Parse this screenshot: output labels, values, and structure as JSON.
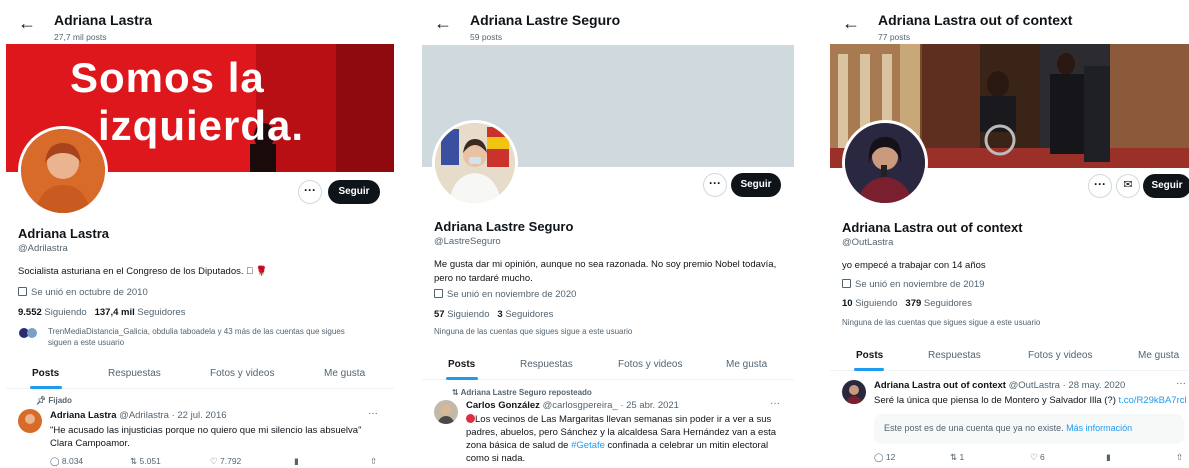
{
  "profiles": [
    {
      "header_name": "Adriana Lastra",
      "header_posts": "27,7 mil posts",
      "banner_text_1": "Somos la",
      "banner_text_2": "izquierda.",
      "more_label": "···",
      "follow_label": "Seguir",
      "display_name": "Adriana Lastra",
      "handle": "@Adrilastra",
      "bio": "Socialista asturiana en el Congreso de los Diputados. 🏻 🌹",
      "joined": "Se unió en octubre de 2010",
      "following_count": "9.552",
      "following_label": "Siguiendo",
      "followers_count": "137,4 mil",
      "followers_label": "Seguidores",
      "followers_note": "TrenMediaDistancia_Galicia, obdulia taboadela y 43 más de las cuentas que sigues siguen a este usuario",
      "tabs": [
        "Posts",
        "Respuestas",
        "Fotos y videos",
        "Me gusta"
      ],
      "pinned_label": "Fijado",
      "tweet_author": "Adriana Lastra",
      "tweet_meta": "@Adrilastra · 22 jul. 2016",
      "tweet_text": "\"He acusado las injusticias porque no quiero que mi silencio las absuelva\" Clara Campoamor.",
      "tweet_dots": "···",
      "replies": "8.034",
      "retweets": "5.051",
      "likes": "7.792"
    },
    {
      "header_name": "Adriana Lastre Seguro",
      "header_posts": "59 posts",
      "more_label": "···",
      "follow_label": "Seguir",
      "display_name": "Adriana Lastre Seguro",
      "handle": "@LastreSeguro",
      "bio": "Me gusta dar mi opinión, aunque no sea razonada. No soy premio Nobel todavía, pero no tardaré mucho.",
      "joined": "Se unió en noviembre de 2020",
      "following_count": "57",
      "following_label": "Siguiendo",
      "followers_count": "3",
      "followers_label": "Seguidores",
      "followers_note": "Ninguna de las cuentas que sigues sigue a este usuario",
      "tabs": [
        "Posts",
        "Respuestas",
        "Fotos y videos",
        "Me gusta"
      ],
      "repost_label": "Adriana Lastre Seguro reposteado",
      "tweet_author": "Carlos González",
      "tweet_meta": "@carlosgpereira_ · 25 abr. 2021",
      "tweet_text_pre": "Los vecinos de Las Margaritas llevan semanas sin poder ir a ver a sus padres, abuelos, pero Sánchez y la alcaldesa Sara Hernández van a esta zona básica de salud de ",
      "tweet_hashtag": "#Getafe",
      "tweet_text_post": " confinada a celebrar un mitin electoral como si nada.",
      "tweet_dots": "···"
    },
    {
      "header_name": "Adriana Lastra out of context",
      "header_posts": "77 posts",
      "more_label": "···",
      "follow_label": "Seguir",
      "display_name": "Adriana Lastra out of context",
      "handle": "@OutLastra",
      "bio": "yo empecé a trabajar con 14 años",
      "joined": "Se unió en noviembre de 2019",
      "following_count": "10",
      "following_label": "Siguiendo",
      "followers_count": "379",
      "followers_label": "Seguidores",
      "followers_note": "Ninguna de las cuentas que sigues sigue a este usuario",
      "tabs": [
        "Posts",
        "Respuestas",
        "Fotos y videos",
        "Me gusta"
      ],
      "tweet_author": "Adriana Lastra out of context",
      "tweet_meta": "@OutLastra · 28 may. 2020",
      "tweet_text": "Seré la única que piensa lo de Montero y Salvador Illa (?) ",
      "tweet_link": "t.co/R29kBA7rcl",
      "tweet_dots": "···",
      "notice_text": "Este post es de una cuenta que ya no existe. ",
      "notice_link": "Más información",
      "replies": "12",
      "retweets": "1",
      "likes": "6"
    }
  ],
  "colors": {
    "accent": "#1d9bf0",
    "banner_red": "#e0191b",
    "banner_gray": "#cfd9de",
    "text": "#0f1419",
    "muted": "#536471"
  }
}
